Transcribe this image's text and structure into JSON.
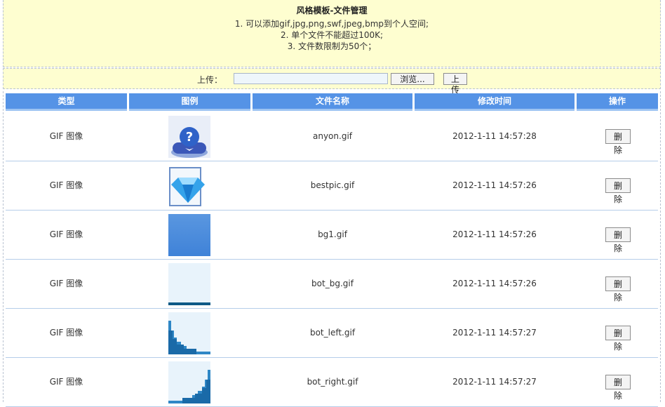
{
  "header": {
    "title": "风格模板-文件管理",
    "rules": [
      "1.   可以添加gif,jpg,png,swf,jpeg,bmp到个人空间;",
      "2.   单个文件不能超过100K;",
      "3.   文件数限制为50个；"
    ]
  },
  "upload": {
    "label": "上传：",
    "input_value": "",
    "browse_label": "浏览...",
    "submit_label": "上传"
  },
  "table": {
    "columns": [
      "类型",
      "图例",
      "文件名称",
      "修改时间",
      "操作"
    ],
    "rows": [
      {
        "type": "GIF 图像",
        "name": "anyon.gif",
        "modified": "2012-1-11 14:57:28",
        "action": "删除",
        "thumb": "anyon-thumbnail"
      },
      {
        "type": "GIF 图像",
        "name": "bestpic.gif",
        "modified": "2012-1-11 14:57:26",
        "action": "删除",
        "thumb": "diamond-thumbnail"
      },
      {
        "type": "GIF 图像",
        "name": "bg1.gif",
        "modified": "2012-1-11 14:57:26",
        "action": "删除",
        "thumb": "blue-gradient-thumbnail"
      },
      {
        "type": "GIF 图像",
        "name": "bot_bg.gif",
        "modified": "2012-1-11 14:57:26",
        "action": "删除",
        "thumb": "bottom-bar-thumbnail"
      },
      {
        "type": "GIF 图像",
        "name": "bot_left.gif",
        "modified": "2012-1-11 14:57:27",
        "action": "删除",
        "thumb": "bottom-left-corner-thumbnail"
      },
      {
        "type": "GIF 图像",
        "name": "bot_right.gif",
        "modified": "2012-1-11 14:57:27",
        "action": "删除",
        "thumb": "bottom-right-corner-thumbnail"
      }
    ]
  },
  "colors": {
    "header_bg": "#5593e6",
    "panel_bg": "#fefed0",
    "row_divider": "#b5cde9"
  }
}
